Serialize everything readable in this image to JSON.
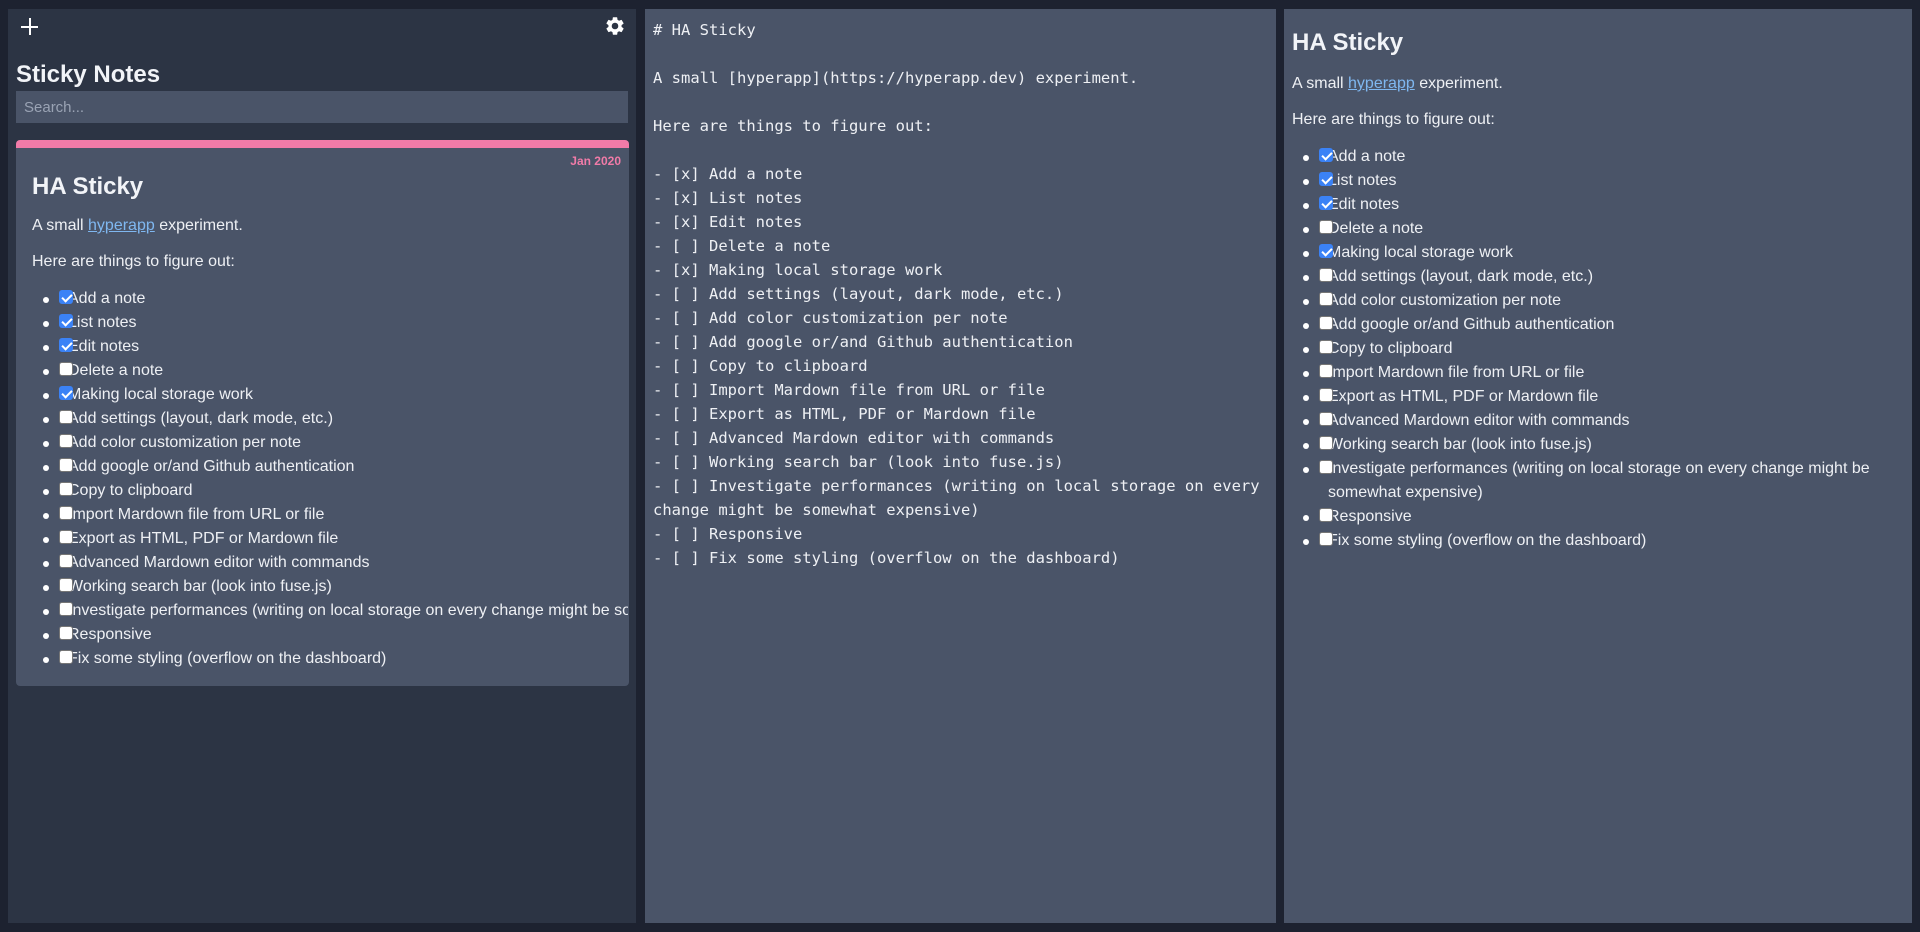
{
  "sidebar": {
    "add_icon": "plus-icon",
    "settings_icon": "gear-icon",
    "title": "Sticky Notes",
    "search_placeholder": "Search..."
  },
  "note": {
    "accent_color": "#f17ba8",
    "date": "Jan 2020",
    "title": "HA Sticky",
    "intro_prefix": "A small",
    "intro_link": "hyperapp",
    "intro_suffix": "experiment.",
    "subheading": "Here are things to figure out:",
    "tasks": [
      {
        "label": "Add a note",
        "done": true
      },
      {
        "label": "List notes",
        "done": true
      },
      {
        "label": "Edit notes",
        "done": true
      },
      {
        "label": "Delete a note",
        "done": false
      },
      {
        "label": "Making local storage work",
        "done": true
      },
      {
        "label": "Add settings (layout, dark mode, etc.)",
        "done": false
      },
      {
        "label": "Add color customization per note",
        "done": false
      },
      {
        "label": "Add google or/and Github authentication",
        "done": false
      },
      {
        "label": "Copy to clipboard",
        "done": false
      },
      {
        "label": "Import Mardown file from URL or file",
        "done": false
      },
      {
        "label": "Export as HTML, PDF or Mardown file",
        "done": false
      },
      {
        "label": "Advanced Mardown editor with commands",
        "done": false
      },
      {
        "label": "Working search bar (look into fuse.js)",
        "done": false
      },
      {
        "label": "Investigate performances (writing on local storage on every change might be somewhat expensive)",
        "done": false
      },
      {
        "label": "Responsive",
        "done": false
      },
      {
        "label": "Fix some styling (overflow on the dashboard)",
        "done": false
      }
    ]
  },
  "editor": {
    "source": "# HA Sticky\n\nA small [hyperapp](https://hyperapp.dev) experiment.\n\nHere are things to figure out:\n\n- [x] Add a note\n- [x] List notes\n- [x] Edit notes\n- [ ] Delete a note\n- [x] Making local storage work\n- [ ] Add settings (layout, dark mode, etc.)\n- [ ] Add color customization per note\n- [ ] Add google or/and Github authentication\n- [ ] Copy to clipboard\n- [ ] Import Mardown file from URL or file\n- [ ] Export as HTML, PDF or Mardown file\n- [ ] Advanced Mardown editor with commands\n- [ ] Working search bar (look into fuse.js)\n- [ ] Investigate performances (writing on local storage on every change might be somewhat expensive)\n- [ ] Responsive\n- [ ] Fix some styling (overflow on the dashboard)"
  },
  "colors": {
    "background": "#1d2230",
    "sidebar": "#2c3444",
    "panel": "#4a5468",
    "link": "#7fb7f0",
    "checkbox": "#3b82f6"
  }
}
